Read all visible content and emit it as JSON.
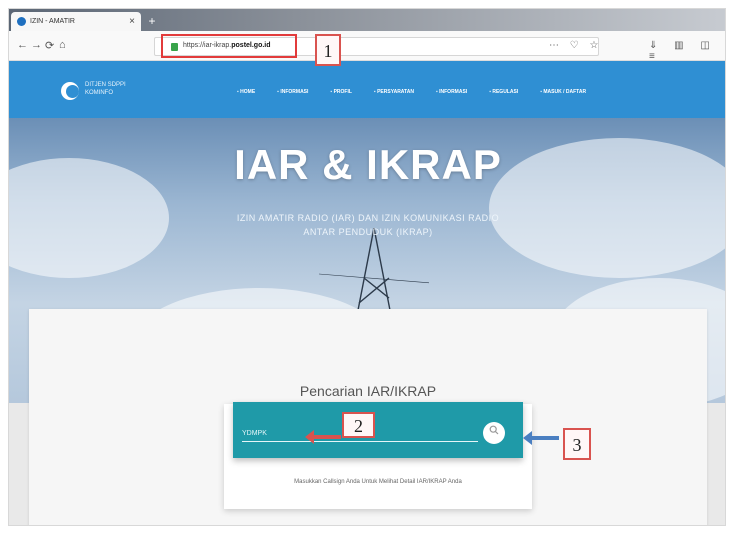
{
  "browser": {
    "tab_title": "IZIN - AMATIR",
    "tab_close": "×",
    "new_tab": "+",
    "nav_icons": [
      "←",
      "→",
      "⟳",
      "⌂"
    ],
    "url_prefix": "https://iar-ikrap.",
    "url_domain": "postel.go.id",
    "url_actions": "⋯ ♡ ☆",
    "toolbar_icons": "⇓ ▥ ◫ ≡"
  },
  "site": {
    "brand": "DITJEN SDPPI KOMINFO",
    "menu": [
      "HOME",
      "INFORMASI",
      "PROFIL",
      "PERSYARATAN",
      "INFORMASI",
      "REGULASI",
      "MASUK / DAFTAR"
    ]
  },
  "hero": {
    "title": "IAR & IKRAP",
    "subtitle": "IZIN AMATIR RADIO (IAR) DAN IZIN KOMUNIKASI RADIO ANTAR PENDUDUK (IKRAP)"
  },
  "search": {
    "heading": "Pencarian IAR/IKRAP",
    "input_value": "",
    "placeholder": "YDMPK",
    "button_icon": "search-icon",
    "hint": "Masukkan Callsign Anda Untuk Melihat Detail IAR/IKRAP Anda"
  },
  "annotations": {
    "label_1": "1",
    "label_2": "2",
    "label_3": "3"
  },
  "colors": {
    "header_blue": "#2f8fd3",
    "search_teal": "#1f9aa8",
    "highlight_red": "#e23b3b",
    "arrow_blue": "#4a7fc1"
  }
}
